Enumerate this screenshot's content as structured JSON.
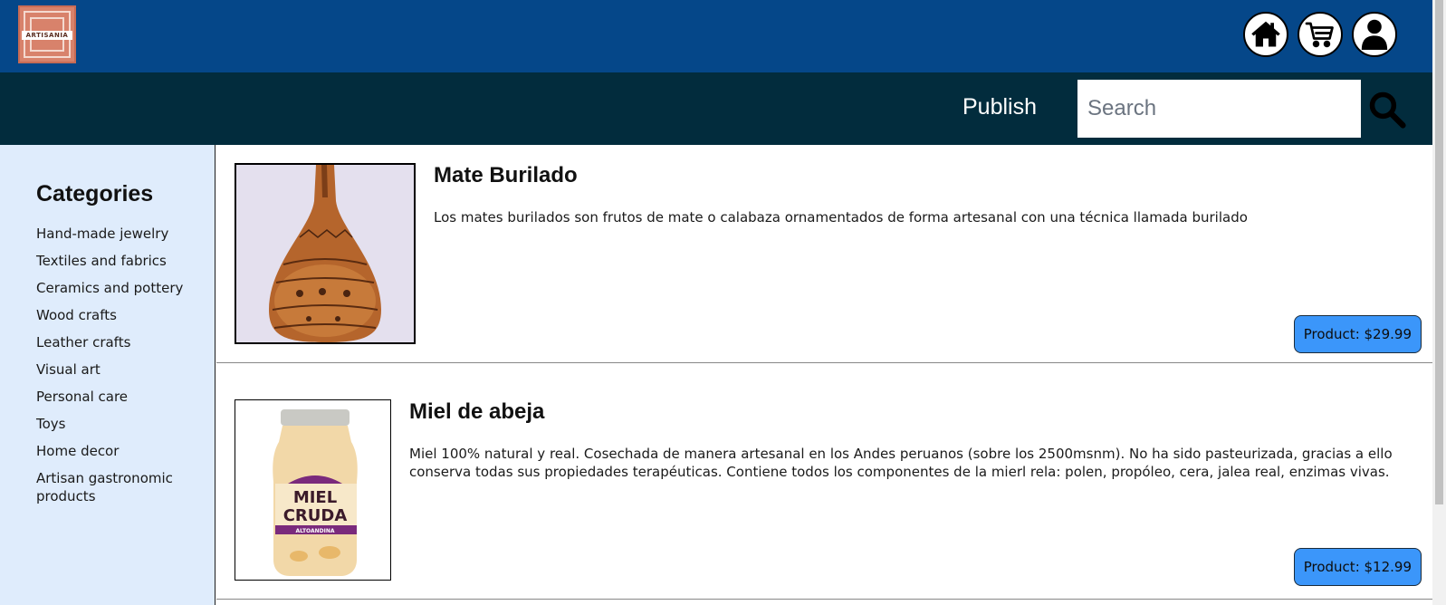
{
  "header": {
    "logo_text": "ARTISANIA",
    "icons": [
      "home-icon",
      "cart-icon",
      "user-icon"
    ]
  },
  "nav": {
    "publish_label": "Publish",
    "search_placeholder": "Search",
    "search_icon": "search-icon"
  },
  "sidebar": {
    "title": "Categories",
    "items": [
      {
        "label": "Hand-made jewelry"
      },
      {
        "label": "Textiles and fabrics"
      },
      {
        "label": "Ceramics and pottery"
      },
      {
        "label": "Wood crafts"
      },
      {
        "label": "Leather crafts"
      },
      {
        "label": "Visual art"
      },
      {
        "label": "Personal care"
      },
      {
        "label": "Toys"
      },
      {
        "label": "Home decor"
      },
      {
        "label": "Artisan gastronomic products"
      }
    ]
  },
  "products": [
    {
      "title": "Mate Burilado",
      "description": "Los mates burilados son frutos de mate o calabaza ornamentados de forma artesanal con una técnica llamada burilado",
      "price_label": "Product: $29.99"
    },
    {
      "title": "Miel de abeja",
      "description": "Miel 100% natural y real. Cosechada de manera artesanal en los Andes peruanos (sobre los 2500msnm). No ha sido pasteurizada, gracias a ello conserva todas sus propiedades terapéuticas. Contiene todos los componentes de la mierl rela: polen, propóleo, cera, jalea real, enzimas vivas.",
      "price_label": "Product: $12.99",
      "image_label_line1": "MIEL",
      "image_label_line2": "CRUDA",
      "image_label_line3": "ALTOANDINA"
    }
  ],
  "colors": {
    "topbar": "#054789",
    "navbar": "#022c3d",
    "sidebar": "#dfecfc",
    "price_button": "#3b96fa"
  }
}
